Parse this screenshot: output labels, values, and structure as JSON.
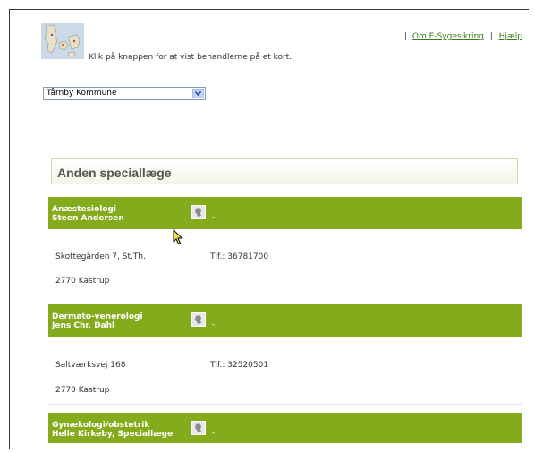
{
  "header": {
    "map_caption": "Klik på knappen for at vist behandlerne på et kort.",
    "links": [
      {
        "label": "Om E-Sygesikring"
      },
      {
        "label": "Hjælp"
      }
    ],
    "separator": "|"
  },
  "municipality_select": {
    "value": "Tårnby Kommune"
  },
  "section": {
    "title": "Anden speciallæge"
  },
  "entries": [
    {
      "specialty": "Anæstesiologi",
      "name": "Steen Andersen",
      "dash": "-",
      "address": "Skottegården 7, St.Th.",
      "phone": "Tlf.: 36781700",
      "city": "2770 Kastrup"
    },
    {
      "specialty": "Dermato-venerologi",
      "name": "Jens Chr. Dahl",
      "dash": "-",
      "address": "Saltværksvej 168",
      "phone": "Tlf.: 32520501",
      "city": "2770 Kastrup"
    },
    {
      "specialty": "Gynækologi/obstetrik",
      "name": "Helle Kirkeby, Speciallæge",
      "dash": "-"
    }
  ],
  "colors": {
    "accent": "#84ab1c",
    "link": "#3a7a18"
  }
}
